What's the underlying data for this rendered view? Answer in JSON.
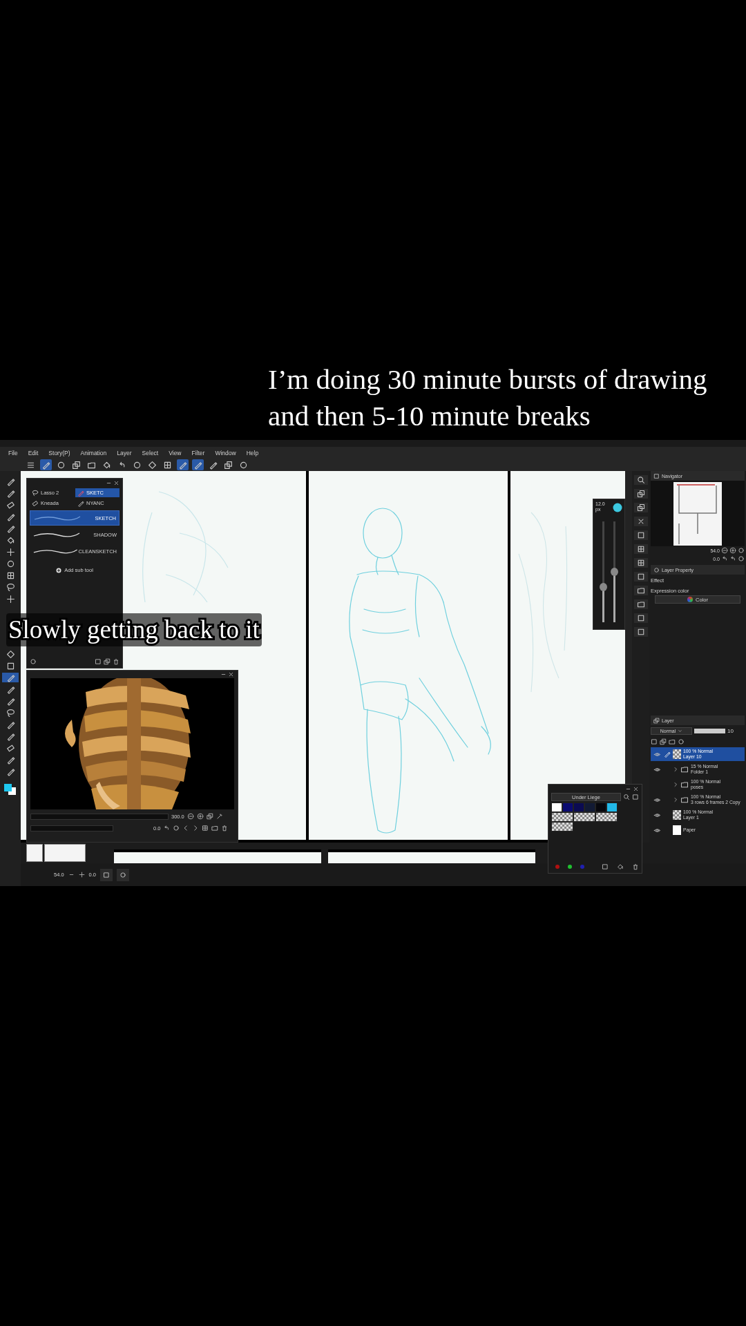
{
  "caption": {
    "lines": [
      "I’m doing 30 minute bursts of drawing",
      "and then 5-10 minute breaks"
    ]
  },
  "overlay_caption": "Slowly getting back to it",
  "menu": [
    "File",
    "Edit",
    "Story(P)",
    "Animation",
    "Layer",
    "Select",
    "View",
    "Filter",
    "Window",
    "Help"
  ],
  "toolbar": [
    {
      "kind": "menu",
      "on": false
    },
    {
      "kind": "pen",
      "on": true
    },
    {
      "kind": "circle",
      "on": false
    },
    {
      "kind": "stack",
      "on": false
    },
    {
      "kind": "folder",
      "on": false
    },
    {
      "kind": "bucket",
      "on": false
    },
    {
      "kind": "undo",
      "on": false
    },
    {
      "kind": "circle",
      "on": false
    },
    {
      "kind": "diamond",
      "on": false
    },
    {
      "kind": "grid",
      "on": false
    },
    {
      "kind": "pen",
      "on": true
    },
    {
      "kind": "pen",
      "on": true
    },
    {
      "kind": "pen",
      "on": false
    },
    {
      "kind": "stack",
      "on": false
    },
    {
      "kind": "circle",
      "on": false
    }
  ],
  "tools": [
    {
      "kind": "pen",
      "selected": false
    },
    {
      "kind": "pen",
      "selected": false
    },
    {
      "kind": "eraser",
      "selected": false
    },
    {
      "kind": "pen",
      "selected": false
    },
    {
      "kind": "pen",
      "selected": false
    },
    {
      "kind": "bucket",
      "selected": false
    },
    {
      "kind": "plus",
      "selected": false
    },
    {
      "kind": "circle",
      "selected": false
    },
    {
      "kind": "grid",
      "selected": false
    },
    {
      "kind": "lasso",
      "selected": false
    },
    {
      "kind": "plus",
      "selected": false
    },
    {
      "kind": "diamond",
      "selected": false
    },
    {
      "kind": "square",
      "selected": false
    },
    {
      "kind": "pen",
      "selected": true
    },
    {
      "kind": "pen",
      "selected": false
    },
    {
      "kind": "pen",
      "selected": false
    },
    {
      "kind": "lasso",
      "selected": false
    },
    {
      "kind": "pen",
      "selected": false
    },
    {
      "kind": "pen",
      "selected": false
    },
    {
      "kind": "eraser",
      "selected": false
    },
    {
      "kind": "pen",
      "selected": false
    },
    {
      "kind": "pen",
      "selected": false
    }
  ],
  "tool_panel": {
    "sub_tools": [
      {
        "label": "Lasso 2",
        "kind": "lasso",
        "selected": false
      },
      {
        "label": "SKETC",
        "kind": "pen",
        "selected": true
      },
      {
        "label": "Kneada",
        "kind": "eraser",
        "selected": false
      },
      {
        "label": "NYANC",
        "kind": "pen",
        "selected": false
      }
    ],
    "brushes": [
      {
        "label": "SKETCH",
        "selected": true
      },
      {
        "label": "SHADOW",
        "selected": false
      },
      {
        "label": "CLEANSKETCH",
        "selected": false
      }
    ],
    "add_label": "Add sub tool"
  },
  "brush_size": {
    "value": "12.0",
    "unit": "px",
    "sliders": [
      {
        "level": 0.35
      },
      {
        "level": 0.5
      }
    ]
  },
  "navigator": {
    "tab": "Navigator",
    "zoom": "54.0",
    "angle": "0.0"
  },
  "layer_property": {
    "tab": "Layer Property",
    "effect_label": "Effect",
    "expression_label": "Expression color",
    "expression_value": "Color"
  },
  "layer_panel": {
    "tab": "Layer",
    "blend": "Normal",
    "opacity_slider": {
      "level": 1
    },
    "opacity": "10",
    "layers": [
      {
        "mode": "100 % Normal",
        "name": "Layer 10",
        "kind": "raster",
        "visible": true,
        "selected": true
      },
      {
        "mode": "15 % Normal",
        "name": "Folder 1",
        "kind": "folder",
        "visible": true,
        "selected": false
      },
      {
        "mode": "100 % Normal",
        "name": "poses",
        "kind": "folder",
        "visible": false,
        "selected": false
      },
      {
        "mode": "100 % Normal",
        "name": "3 rows 6 frames 2 Copy",
        "kind": "folder",
        "visible": true,
        "selected": false
      },
      {
        "mode": "100 % Normal",
        "name": "Layer 1",
        "kind": "raster",
        "visible": true,
        "selected": false
      },
      {
        "name": "Paper",
        "kind": "paper",
        "visible": true,
        "selected": false
      }
    ]
  },
  "reference": {
    "zoom": "300.0",
    "angle": "0.0"
  },
  "bottom_bar": {
    "zoom": "54.0",
    "angle": "0.0"
  },
  "color_set": {
    "name": "Under Liege",
    "swatches": [
      {
        "kind": "color",
        "color": "#ffffff"
      },
      {
        "kind": "color",
        "color": "#0a0a70"
      },
      {
        "kind": "color",
        "color": "#0b0b52"
      },
      {
        "kind": "color",
        "color": "#121a34"
      },
      {
        "kind": "color",
        "color": "#08080e"
      },
      {
        "kind": "color",
        "color": "#22b8e8"
      },
      {
        "kind": "transparent"
      },
      {
        "kind": "transparent"
      },
      {
        "kind": "transparent"
      },
      {
        "kind": "transparent"
      }
    ],
    "channels": [
      {
        "color": "#b01010"
      },
      {
        "color": "#20c030"
      },
      {
        "color": "#2020b0"
      }
    ]
  }
}
